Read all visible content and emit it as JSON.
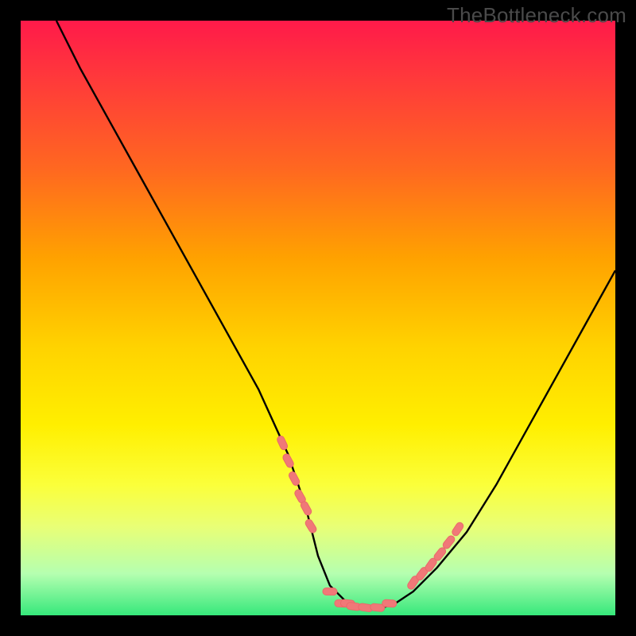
{
  "watermark": "TheBottleneck.com",
  "chart_data": {
    "type": "line",
    "title": "",
    "xlabel": "",
    "ylabel": "",
    "x_range": [
      0,
      100
    ],
    "y_range": [
      0,
      100
    ],
    "curve": {
      "x": [
        6,
        10,
        15,
        20,
        25,
        30,
        35,
        40,
        45,
        48,
        50,
        52,
        55,
        58,
        60,
        63,
        66,
        70,
        75,
        80,
        85,
        90,
        95,
        100
      ],
      "y": [
        100,
        92,
        83,
        74,
        65,
        56,
        47,
        38,
        27,
        18,
        10,
        5,
        2,
        1,
        1,
        2,
        4,
        8,
        14,
        22,
        31,
        40,
        49,
        58
      ]
    },
    "series": [
      {
        "name": "left-cluster",
        "x": [
          44,
          45,
          46,
          47,
          48,
          48.8
        ],
        "y": [
          29,
          26,
          23,
          20,
          18,
          15
        ]
      },
      {
        "name": "bottom-cluster",
        "x": [
          52,
          54,
          55,
          56,
          58,
          60,
          62
        ],
        "y": [
          4,
          2,
          2,
          1.5,
          1.3,
          1.3,
          2
        ]
      },
      {
        "name": "right-cluster",
        "x": [
          66,
          67.5,
          69,
          70.5,
          72,
          73.5
        ],
        "y": [
          5.5,
          7,
          8.5,
          10.3,
          12.3,
          14.5
        ]
      }
    ],
    "marker_color": "#f07878"
  }
}
